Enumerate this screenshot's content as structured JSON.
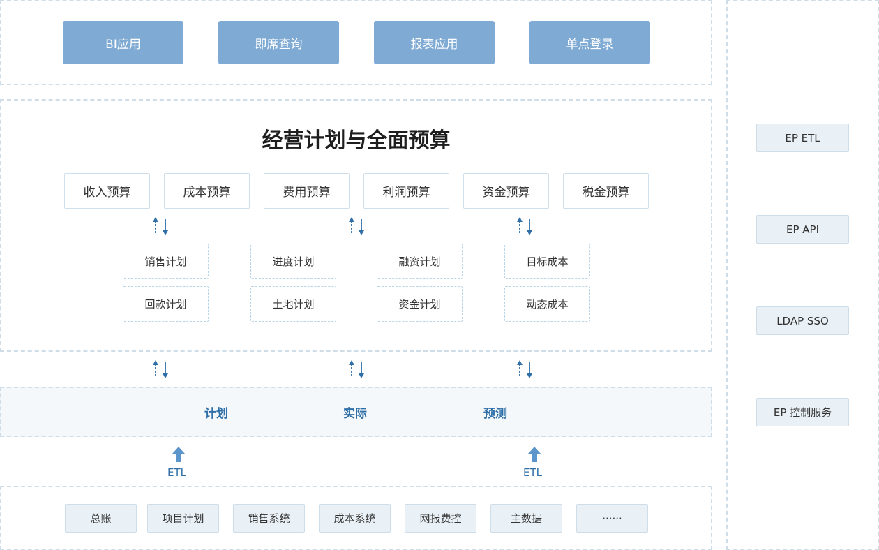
{
  "top_apps": [
    "BI应用",
    "即席查询",
    "报表应用",
    "单点登录"
  ],
  "main": {
    "title": "经营计划与全面预算",
    "budgets": [
      "收入预算",
      "成本预算",
      "费用预算",
      "利润预算",
      "资金预算",
      "税金预算"
    ],
    "plans": [
      [
        "销售计划",
        "回款计划"
      ],
      [
        "进度计划",
        "土地计划"
      ],
      [
        "融资计划",
        "资金计划"
      ],
      [
        "目标成本",
        "动态成本"
      ]
    ]
  },
  "data_layer": [
    "计划",
    "实际",
    "预测"
  ],
  "etl_label": "ETL",
  "sources": [
    "总账",
    "项目计划",
    "销售系统",
    "成本系统",
    "网报费控",
    "主数据",
    "······"
  ],
  "side_services": [
    "EP ETL",
    "EP API",
    "LDAP SSO",
    "EP 控制服务"
  ],
  "colors": {
    "top_button_bg": "#7faad3",
    "accent_blue": "#2f6fa8",
    "panel_border": "#cfdde9",
    "box_bg": "#e9f0f6"
  }
}
